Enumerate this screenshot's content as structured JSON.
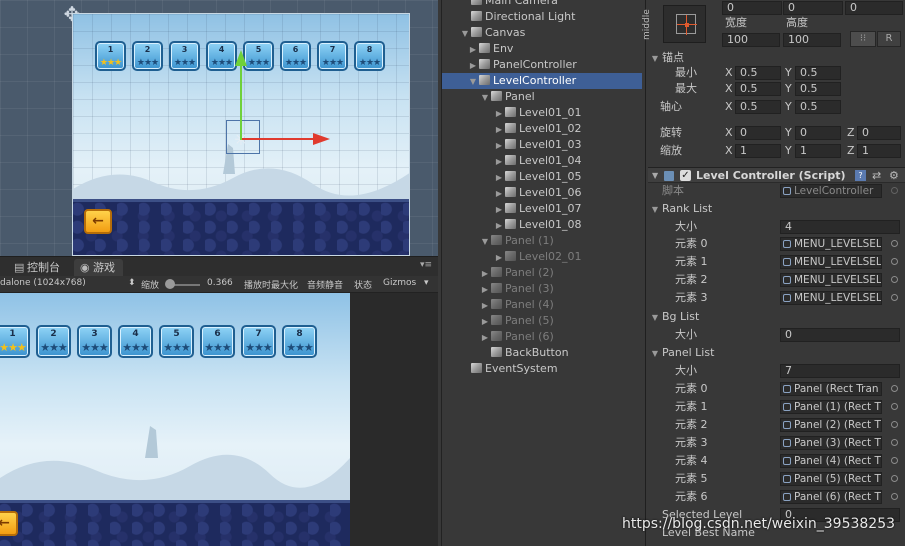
{
  "colors": {
    "accent_selected": "#3e5f96",
    "gizmo_x": "#e03a2e",
    "gizmo_y": "#6fd13a",
    "star": "#f3c11b"
  },
  "scene": {
    "level_numbers": [
      "1",
      "2",
      "3",
      "4",
      "5",
      "6",
      "7",
      "8"
    ],
    "back_icon": "←"
  },
  "gameview": {
    "tabs": [
      {
        "label": "控制台",
        "icon": "console-icon"
      },
      {
        "label": "游戏",
        "icon": "game-icon"
      }
    ],
    "aspect": "dalone (1024x768)",
    "scale_label": "缩放",
    "scale_value": "0.366",
    "maximize_label": "播放时最大化",
    "mute_label": "音频静音",
    "stats_label": "状态",
    "gizmos_label": "Gizmos",
    "level_numbers": [
      "1",
      "2",
      "3",
      "4",
      "5",
      "6",
      "7",
      "8"
    ],
    "back_icon": "←"
  },
  "hierarchy": {
    "items": [
      {
        "label": "Main Camera",
        "depth": 1
      },
      {
        "label": "Directional Light",
        "depth": 1
      },
      {
        "label": "Canvas",
        "depth": 1,
        "expanded": true
      },
      {
        "label": "Env",
        "depth": 2,
        "collapsed": true
      },
      {
        "label": "PanelController",
        "depth": 2,
        "collapsed": true
      },
      {
        "label": "LevelController",
        "depth": 2,
        "expanded": true,
        "selected": true
      },
      {
        "label": "Panel",
        "depth": 3,
        "expanded": true
      },
      {
        "label": "Level01_01",
        "depth": 4,
        "collapsed": true
      },
      {
        "label": "Level01_02",
        "depth": 4,
        "collapsed": true
      },
      {
        "label": "Level01_03",
        "depth": 4,
        "collapsed": true
      },
      {
        "label": "Level01_04",
        "depth": 4,
        "collapsed": true
      },
      {
        "label": "Level01_05",
        "depth": 4,
        "collapsed": true
      },
      {
        "label": "Level01_06",
        "depth": 4,
        "collapsed": true
      },
      {
        "label": "Level01_07",
        "depth": 4,
        "collapsed": true
      },
      {
        "label": "Level01_08",
        "depth": 4,
        "collapsed": true
      },
      {
        "label": "Panel (1)",
        "depth": 3,
        "expanded": true,
        "inactive": true
      },
      {
        "label": "Level02_01",
        "depth": 4,
        "collapsed": true,
        "inactive": true
      },
      {
        "label": "Panel (2)",
        "depth": 3,
        "collapsed": true,
        "inactive": true
      },
      {
        "label": "Panel (3)",
        "depth": 3,
        "collapsed": true,
        "inactive": true
      },
      {
        "label": "Panel (4)",
        "depth": 3,
        "collapsed": true,
        "inactive": true
      },
      {
        "label": "Panel (5)",
        "depth": 3,
        "collapsed": true,
        "inactive": true
      },
      {
        "label": "Panel (6)",
        "depth": 3,
        "collapsed": true,
        "inactive": true
      },
      {
        "label": "BackButton",
        "depth": 3
      },
      {
        "label": "EventSystem",
        "depth": 1
      }
    ]
  },
  "inspector": {
    "anchor_preset": "middle",
    "pos": [
      "0",
      "0",
      "0"
    ],
    "width_label": "宽度",
    "height_label": "高度",
    "width": "100",
    "height": "100",
    "raw_btn": "R",
    "anchors_label": "锚点",
    "min_label": "最小",
    "max_label": "最大",
    "pivot_label": "轴心",
    "min": [
      "0.5",
      "0.5"
    ],
    "max": [
      "0.5",
      "0.5"
    ],
    "pivot": [
      "0.5",
      "0.5"
    ],
    "rotation_label": "旋转",
    "rotation": [
      "0",
      "0",
      "0"
    ],
    "scale_label": "缩放",
    "scale": [
      "1",
      "1",
      "1"
    ],
    "component_title": "Level Controller (Script)",
    "script_label": "脚本",
    "script_value": "LevelController",
    "rank_list_label": "Rank List",
    "size_label": "大小",
    "rank_size": "4",
    "element_labels": [
      "元素 0",
      "元素 1",
      "元素 2",
      "元素 3",
      "元素 4",
      "元素 5",
      "元素 6"
    ],
    "rank_items": [
      "MENU_LEVELSEL",
      "MENU_LEVELSEL",
      "MENU_LEVELSEL",
      "MENU_LEVELSEL"
    ],
    "bg_list_label": "Bg List",
    "bg_size": "0",
    "panel_list_label": "Panel List",
    "panel_size": "7",
    "panel_items": [
      "Panel (Rect Tran",
      "Panel (1) (Rect T",
      "Panel (2) (Rect T",
      "Panel (3) (Rect T",
      "Panel (4) (Rect T",
      "Panel (5) (Rect T",
      "Panel (6) (Rect T"
    ],
    "selected_level_label": "Selected Level",
    "selected_level": "0",
    "level_best_label": "Level Best Name"
  },
  "watermark": "https://blog.csdn.net/weixin_39538253"
}
